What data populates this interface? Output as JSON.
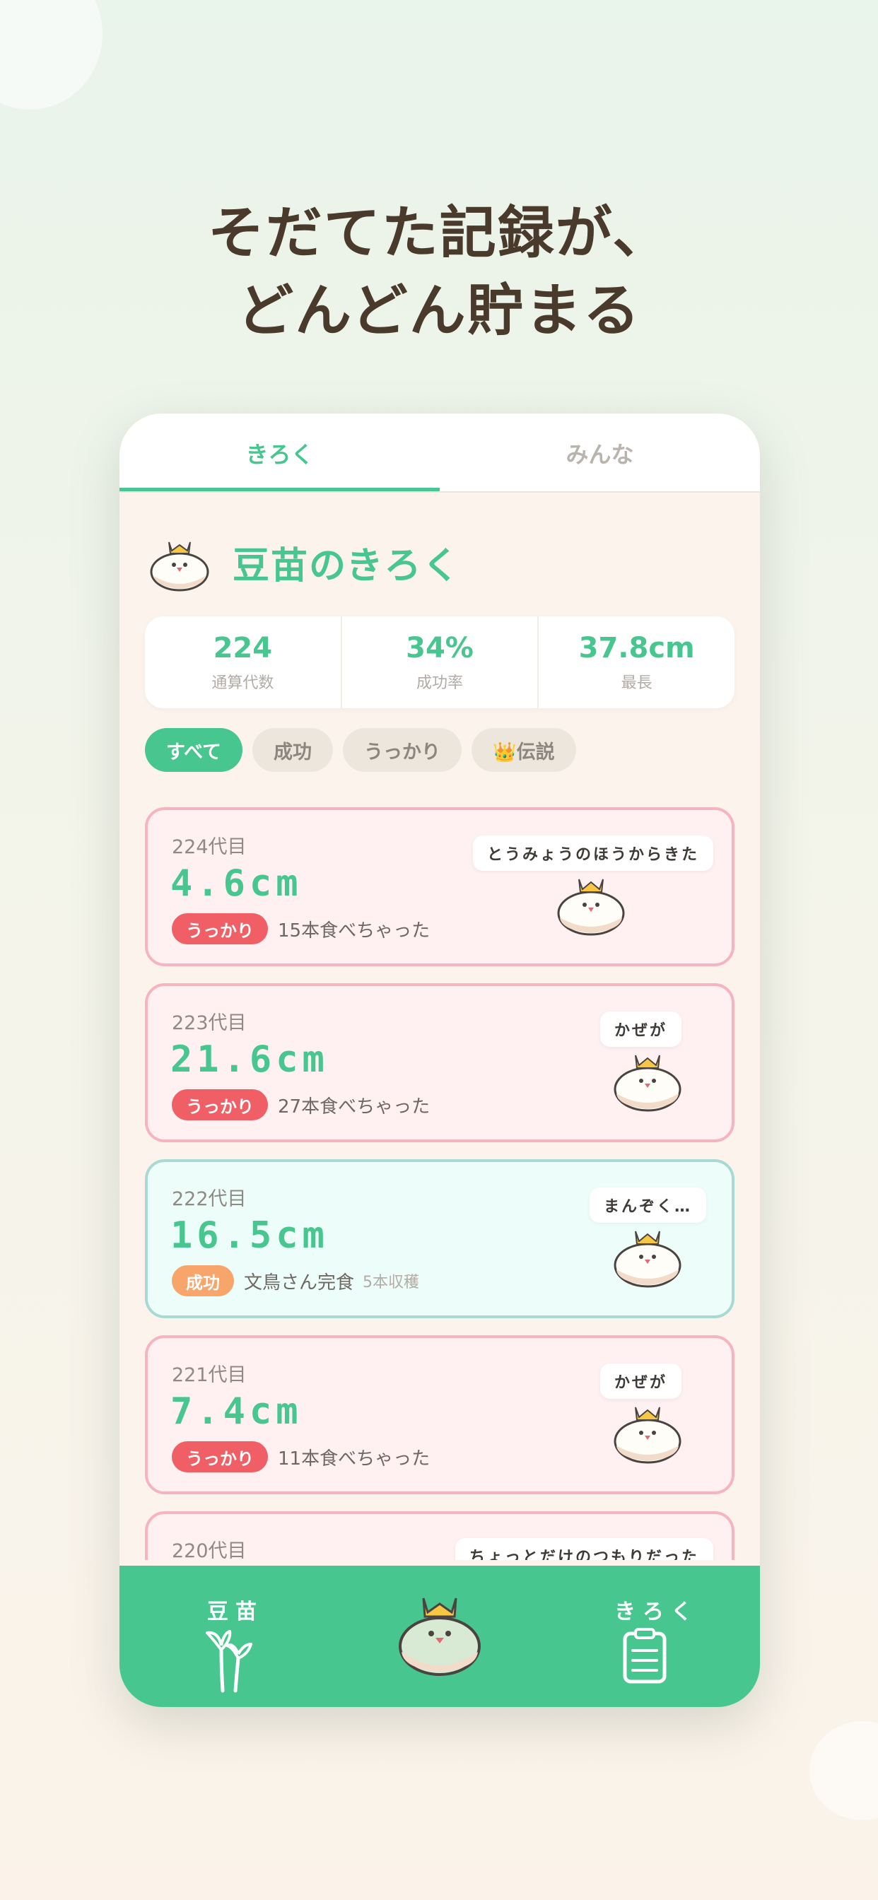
{
  "headline": {
    "line1": "そだてた記録が、",
    "line2": "どんどん貯まる"
  },
  "tabs": [
    {
      "label": "きろく",
      "active": true
    },
    {
      "label": "みんな",
      "active": false
    }
  ],
  "profile": {
    "title": "豆苗のきろく"
  },
  "stats": [
    {
      "value": "224",
      "label": "通算代数"
    },
    {
      "value": "34%",
      "label": "成功率"
    },
    {
      "value": "37.8cm",
      "label": "最長"
    }
  ],
  "filters": [
    {
      "label": "すべて",
      "active": true
    },
    {
      "label": "成功",
      "active": false
    },
    {
      "label": "うっかり",
      "active": false
    },
    {
      "label": "👑伝説",
      "active": false
    }
  ],
  "records": [
    {
      "generation": "224代目",
      "length": "4.6cm",
      "status": "うっかり",
      "note": "15本食べちゃった",
      "subnote": "",
      "bubble": "とうみょうのほうからきた",
      "type": "fail"
    },
    {
      "generation": "223代目",
      "length": "21.6cm",
      "status": "うっかり",
      "note": "27本食べちゃった",
      "subnote": "",
      "bubble": "かぜが",
      "type": "fail"
    },
    {
      "generation": "222代目",
      "length": "16.5cm",
      "status": "成功",
      "note": "文鳥さん完食",
      "subnote": "5本収穫",
      "bubble": "まんぞく…",
      "type": "success"
    },
    {
      "generation": "221代目",
      "length": "7.4cm",
      "status": "うっかり",
      "note": "11本食べちゃった",
      "subnote": "",
      "bubble": "かぜが",
      "type": "fail"
    },
    {
      "generation": "220代目",
      "length": "",
      "status": "",
      "note": "",
      "subnote": "",
      "bubble": "ちょっとだけのつもりだった",
      "type": "fail"
    }
  ],
  "bottom_nav": {
    "left_label": "豆苗",
    "right_label": "きろく"
  },
  "colors": {
    "accent": "#48c690",
    "fail_badge": "#f05f66",
    "success_badge": "#f8a56c",
    "headline": "#4a3a2c"
  },
  "icons": {
    "seedling": "seedling-icon",
    "clipboard": "clipboard-icon",
    "mascot": "bird-mascot-icon",
    "crown": "crown-icon"
  }
}
